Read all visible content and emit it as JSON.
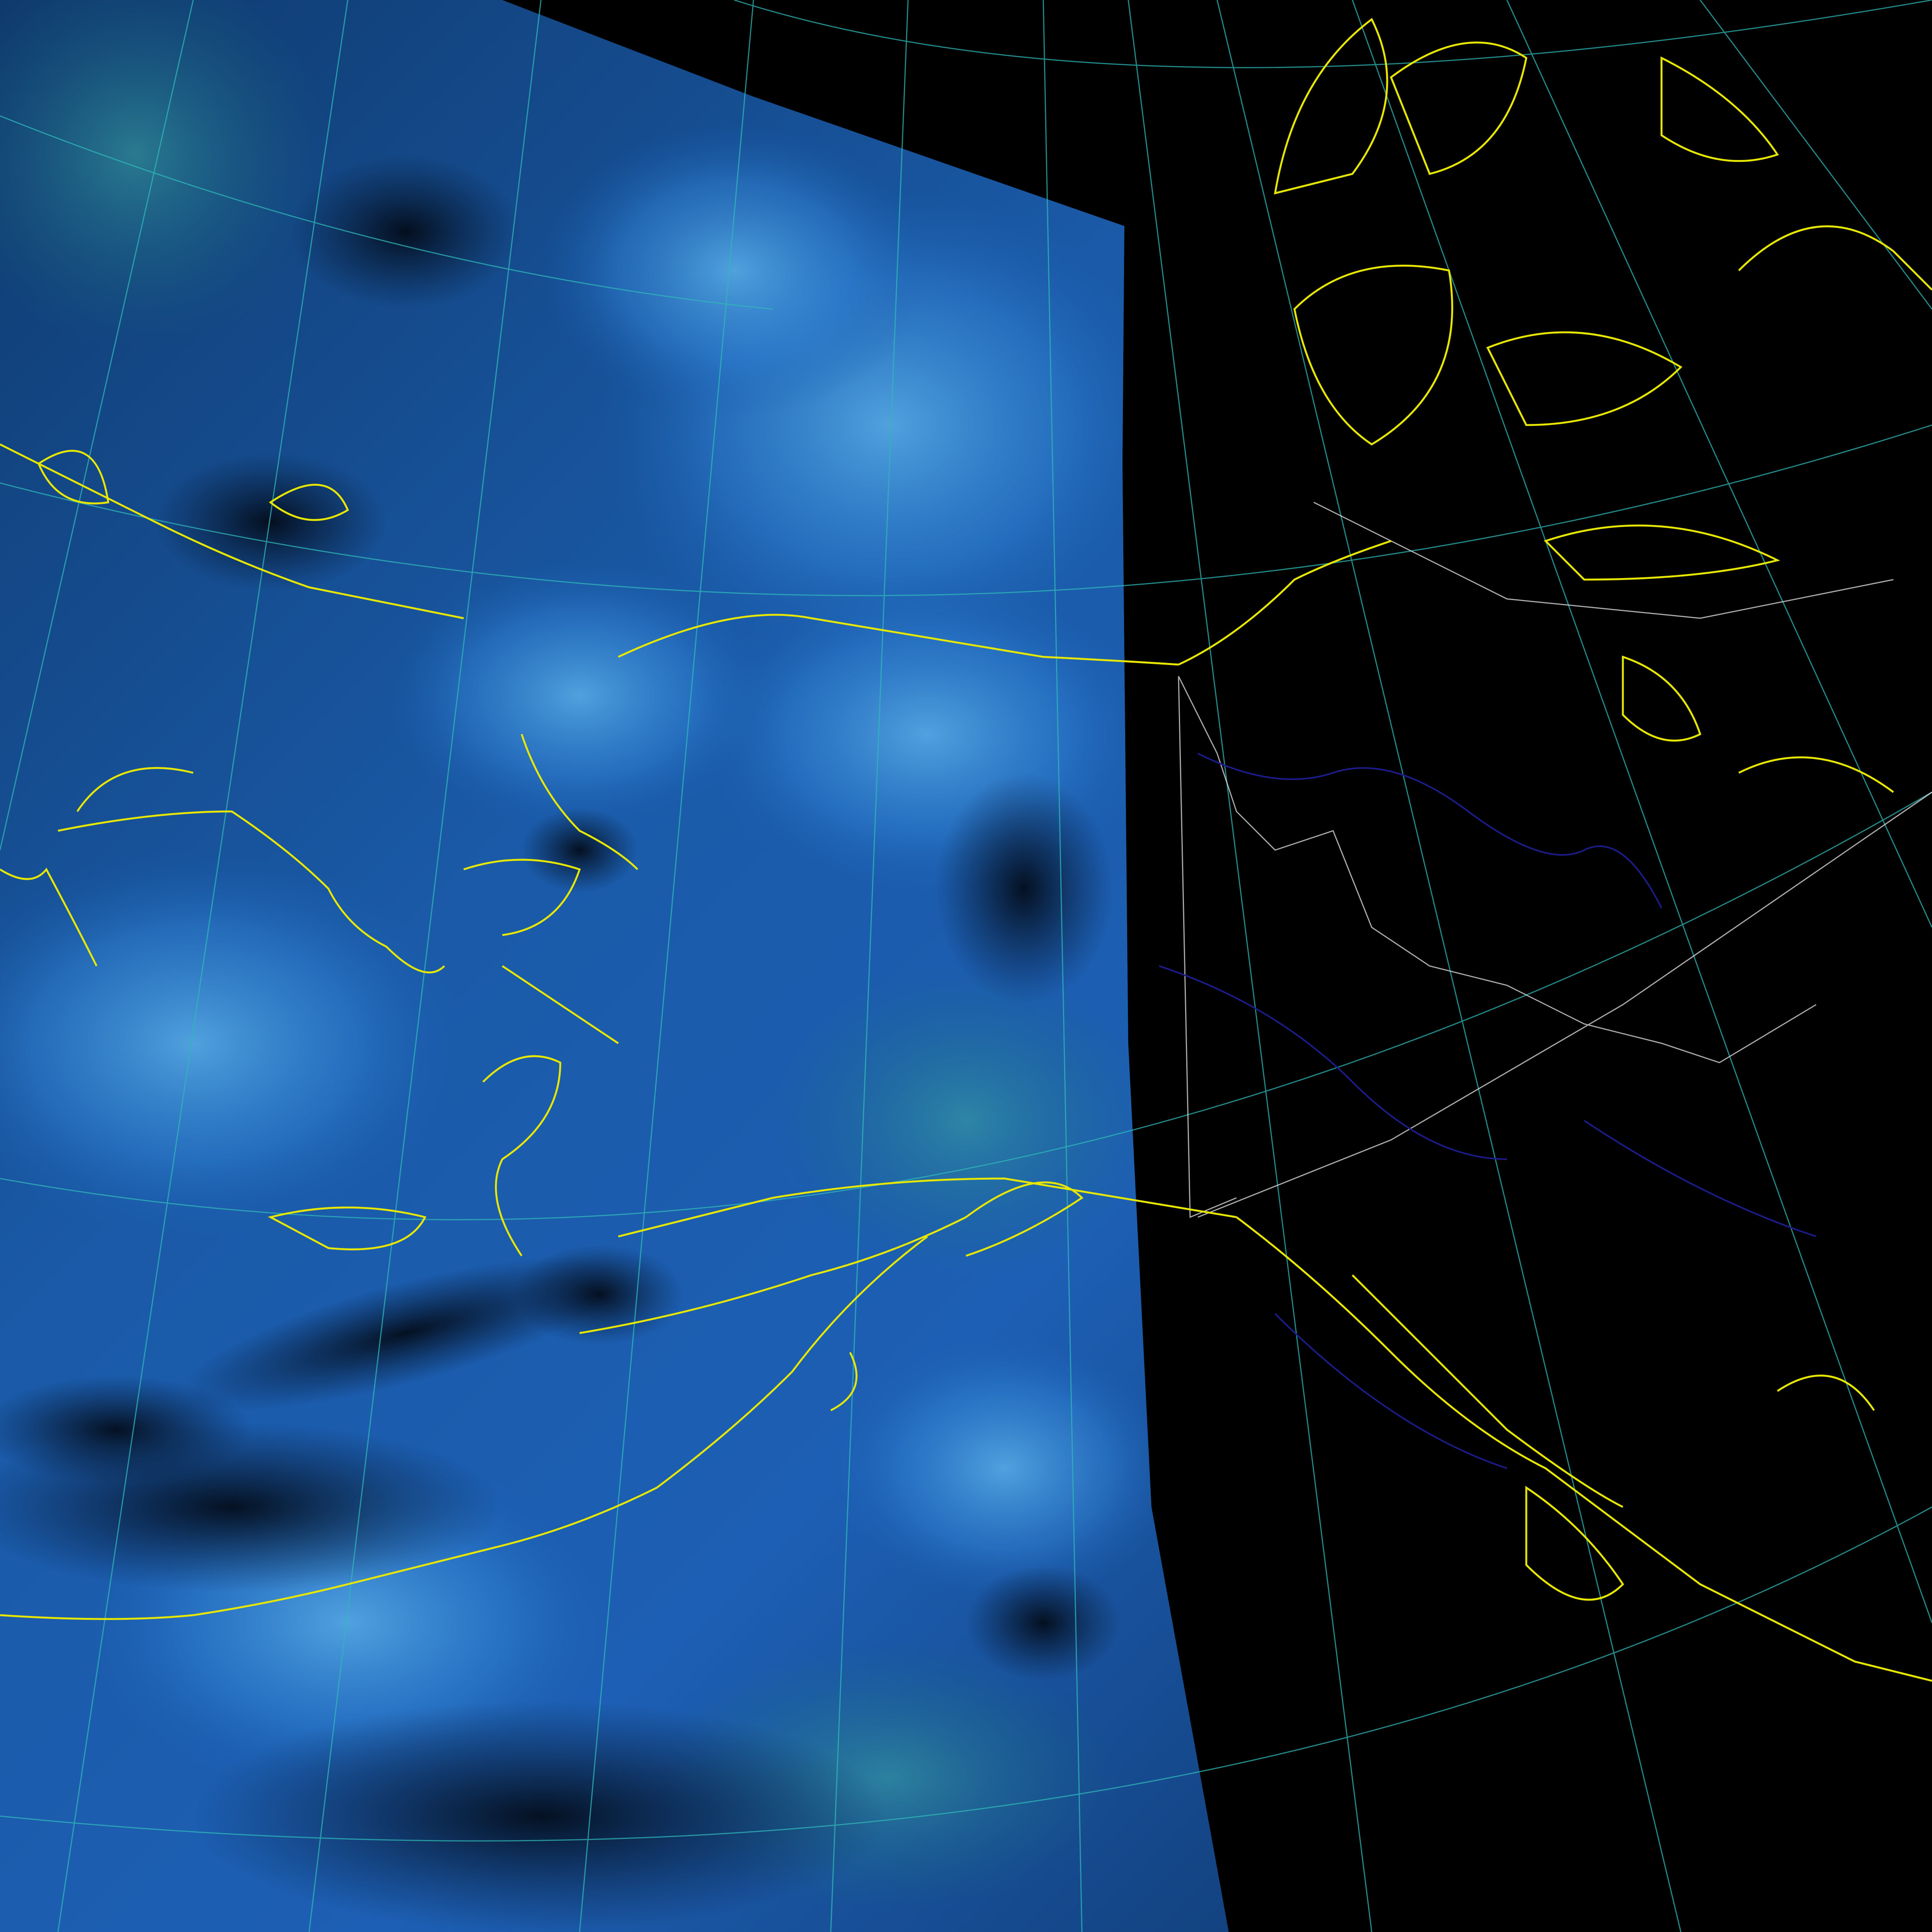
{
  "image": {
    "kind": "satellite swath over a polar map projection",
    "visible_text": []
  },
  "colors": {
    "background": "#000000",
    "coastline": "#e6e600",
    "graticule": "#2fb8b8",
    "political_border": "#d8d8d8",
    "rivers": "#1c1c8c",
    "cloud_bright": "#4a9fe0",
    "cloud_mid": "#1a5fb0",
    "cloud_dark": "#0a2246",
    "cloud_teal": "#2a8a8c"
  },
  "layers": [
    {
      "name": "satellite-swath",
      "visible": true
    },
    {
      "name": "coastlines",
      "visible": true
    },
    {
      "name": "graticule",
      "visible": true
    },
    {
      "name": "political-borders",
      "visible": true
    },
    {
      "name": "rivers",
      "visible": true
    }
  ]
}
